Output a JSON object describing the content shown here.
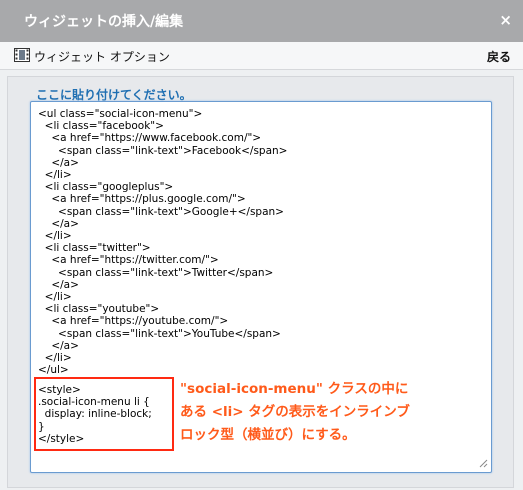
{
  "dialog": {
    "title": "ウィジェットの挿入/編集",
    "close_symbol": "×"
  },
  "options_bar": {
    "label": "ウィジェット オプション",
    "back_label": "戻る",
    "icon": "film-icon"
  },
  "content": {
    "paste_label": "ここに貼り付けてください。",
    "html_code": "<ul class=\"social-icon-menu\">\n  <li class=\"facebook\">\n    <a href=\"https://www.facebook.com/\">\n      <span class=\"link-text\">Facebook</span>\n    </a>\n  </li>\n  <li class=\"googleplus\">\n    <a href=\"https://plus.google.com/\">\n      <span class=\"link-text\">Google+</span>\n    </a>\n  </li>\n  <li class=\"twitter\">\n    <a href=\"https://twitter.com/\">\n      <span class=\"link-text\">Twitter</span>\n    </a>\n  </li>\n  <li class=\"youtube\">\n    <a href=\"https://youtube.com/\">\n      <span class=\"link-text\">YouTube</span>\n    </a>\n  </li>\n</ul>",
    "css_code": "<style>\n.social-icon-menu li {\n  display: inline-block;\n}\n</style>"
  },
  "annotation": {
    "line1": "\"social-icon-menu\" クラスの中に",
    "line2": "ある <li> タグの表示をインラインブ",
    "line3": "ロック型（横並び）にする。"
  },
  "colors": {
    "accent": "#1f6fb2",
    "annotation": "#ff5a1a",
    "highlight_border": "#ff2a12"
  }
}
